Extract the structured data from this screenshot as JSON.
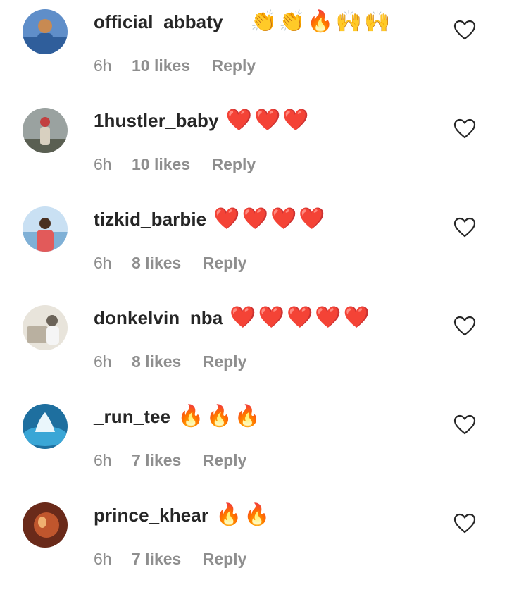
{
  "comments": [
    {
      "username": "official_abbaty__",
      "text": "👏👏🔥🙌🙌",
      "time": "6h",
      "likes": "10 likes",
      "reply_label": "Reply",
      "avatar_colors": [
        "#5f8ec9",
        "#2f5e9b",
        "#c88a52"
      ]
    },
    {
      "username": "1hustler_baby",
      "text": "❤️❤️❤️",
      "time": "6h",
      "likes": "10 likes",
      "reply_label": "Reply",
      "avatar_colors": [
        "#9aa2a0",
        "#5a5f52",
        "#c24040"
      ]
    },
    {
      "username": "tizkid_barbie",
      "text": "❤️❤️❤️❤️",
      "time": "6h",
      "likes": "8 likes",
      "reply_label": "Reply",
      "avatar_colors": [
        "#c9e0f3",
        "#7fb0d6",
        "#e25a5a"
      ]
    },
    {
      "username": "donkelvin_nba",
      "text": "❤️❤️❤️❤️❤️",
      "time": "6h",
      "likes": "8 likes",
      "reply_label": "Reply",
      "avatar_colors": [
        "#e8e4db",
        "#b9b0a0",
        "#6b6358"
      ]
    },
    {
      "username": "_run_tee",
      "text": "🔥🔥🔥",
      "time": "6h",
      "likes": "7 likes",
      "reply_label": "Reply",
      "avatar_colors": [
        "#1e6f9f",
        "#3aa6d6",
        "#eaf6fb"
      ]
    },
    {
      "username": "prince_khear",
      "text": "🔥🔥",
      "time": "6h",
      "likes": "7 likes",
      "reply_label": "Reply",
      "avatar_colors": [
        "#6a2a1a",
        "#c0562d",
        "#f0b070"
      ]
    }
  ],
  "icons": {
    "like": "heart-outline-icon"
  }
}
